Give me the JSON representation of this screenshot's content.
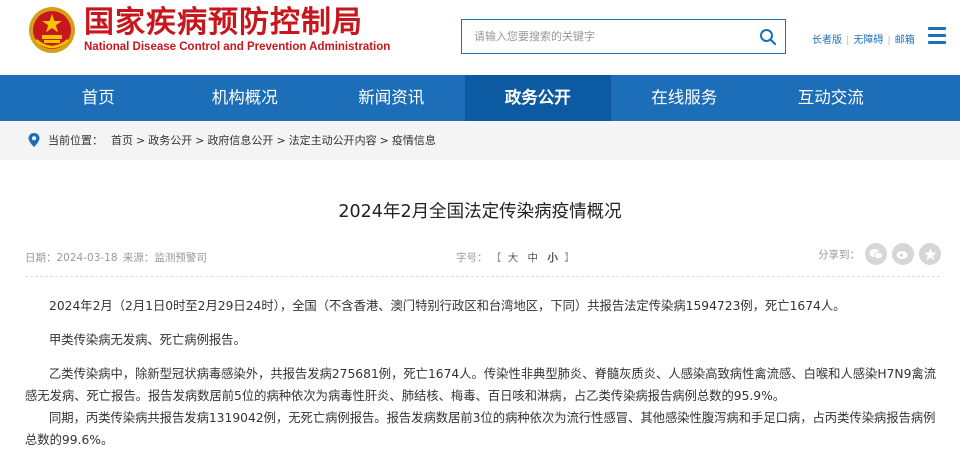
{
  "header": {
    "title_cn": "国家疾病预防控制局",
    "title_en": "National Disease Control and Prevention Administration",
    "search_placeholder": "请输入您要搜索的关键字",
    "links": [
      "长者版",
      "无障碍",
      "邮箱"
    ]
  },
  "nav": {
    "items": [
      "首页",
      "机构概况",
      "新闻资讯",
      "政务公开",
      "在线服务",
      "互动交流"
    ],
    "active_index": 3
  },
  "breadcrumb": {
    "label": "当前位置：",
    "items": [
      "首页",
      "政务公开",
      "政府信息公开",
      "法定主动公开内容",
      "疫情信息"
    ],
    "separator": ">"
  },
  "article": {
    "title": "2024年2月全国法定传染病疫情概况",
    "date_label": "日期：",
    "date": "2024-03-18",
    "source_label": "来源：",
    "source": "监测预警司",
    "font_label": "字号：",
    "font_open": "【",
    "font_sizes": [
      "大",
      "中",
      "小"
    ],
    "font_close": "】",
    "share_label": "分享到：",
    "paragraphs": [
      "2024年2月（2月1日0时至2月29日24时），全国（不含香港、澳门特别行政区和台湾地区，下同）共报告法定传染病1594723例，死亡1674人。",
      "甲类传染病无发病、死亡病例报告。",
      "乙类传染病中，除新型冠状病毒感染外，共报告发病275681例，死亡1674人。传染性非典型肺炎、脊髓灰质炎、人感染高致病性禽流感、白喉和人感染H7N9禽流感无发病、死亡报告。报告发病数居前5位的病种依次为病毒性肝炎、肺结核、梅毒、百日咳和淋病，占乙类传染病报告病例总数的95.9%。",
      "同期，丙类传染病共报告发病1319042例，无死亡病例报告。报告发病数居前3位的病种依次为流行性感冒、其他感染性腹泻病和手足口病，占丙类传染病报告病例总数的99.6%。"
    ]
  },
  "colors": {
    "brand_red": "#c8161d",
    "nav_blue": "#1c6eb8",
    "nav_active": "#0c5aa1"
  }
}
